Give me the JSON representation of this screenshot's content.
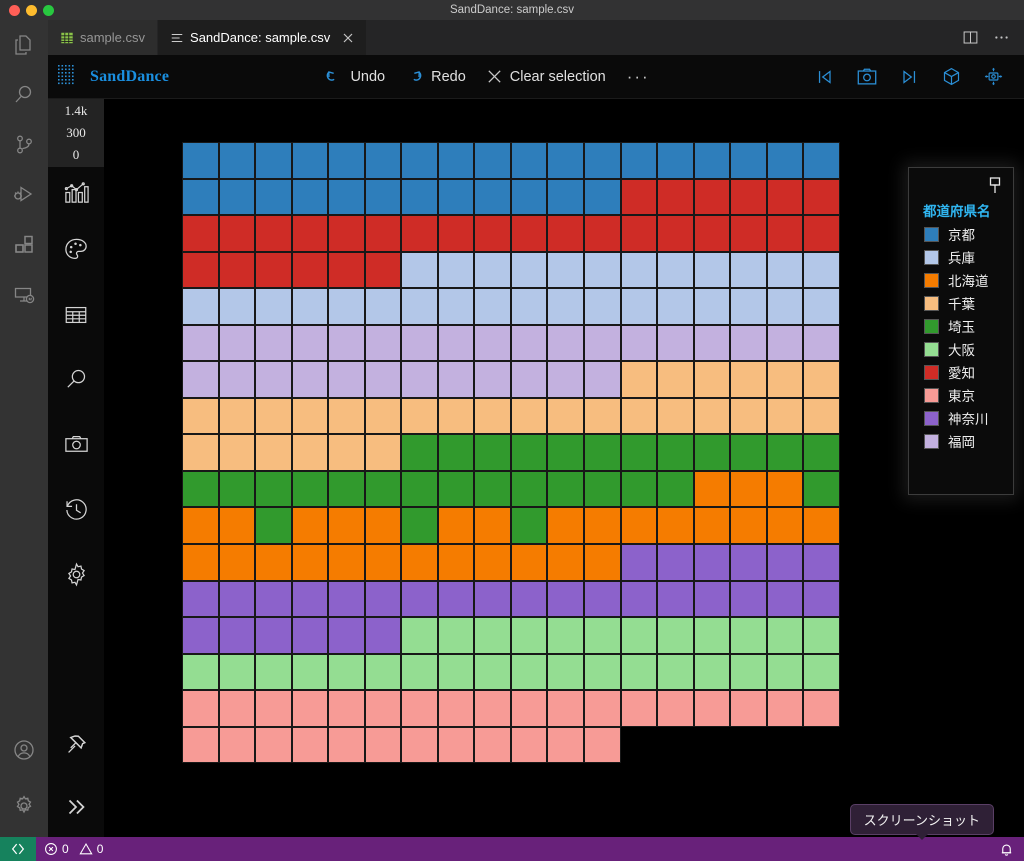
{
  "window": {
    "title": "SandDance: sample.csv"
  },
  "tabs": [
    {
      "label": "sample.csv",
      "icon": "csv-file-icon",
      "active": false,
      "closable": false
    },
    {
      "label": "SandDance: sample.csv",
      "icon": "sanddance-file-icon",
      "active": true,
      "closable": true
    }
  ],
  "tabbar_actions": [
    {
      "name": "split-editor-icon"
    },
    {
      "name": "more-actions-icon"
    }
  ],
  "activitybar": {
    "items": [
      {
        "name": "explorer-icon",
        "active": false
      },
      {
        "name": "search-icon",
        "active": false
      },
      {
        "name": "source-control-icon",
        "active": false
      },
      {
        "name": "run-and-debug-icon",
        "active": false
      },
      {
        "name": "extensions-icon",
        "active": false
      },
      {
        "name": "remote-explorer-icon",
        "active": false
      }
    ],
    "bottom": [
      {
        "name": "account-icon"
      },
      {
        "name": "manage-settings-icon"
      }
    ]
  },
  "sanddance": {
    "brand": "SandDance",
    "logo_icon": "sanddance-dot-matrix-logo",
    "toolbar": {
      "undo_label": "Undo",
      "redo_label": "Redo",
      "clear_selection_label": "Clear selection",
      "more_label": "···"
    },
    "toolbar_right_icons": [
      {
        "name": "previous-snapshot-icon"
      },
      {
        "name": "camera-snapshot-icon"
      },
      {
        "name": "next-snapshot-icon"
      },
      {
        "name": "chart-3d-cube-icon"
      },
      {
        "name": "camera-home-reset-icon"
      }
    ],
    "rail": {
      "axis_ticks": [
        "1.4k",
        "300",
        "0"
      ],
      "icons": [
        {
          "name": "chart-icon"
        },
        {
          "name": "color-palette-icon"
        },
        {
          "name": "data-grid-icon"
        },
        {
          "name": "search-icon"
        },
        {
          "name": "snapshot-camera-icon"
        },
        {
          "name": "history-icon"
        },
        {
          "name": "settings-gear-icon"
        }
      ],
      "bottom_icons": [
        {
          "name": "pin-icon"
        },
        {
          "name": "chevron-double-right-icon"
        }
      ]
    },
    "legend": {
      "pin_icon": "pin-icon",
      "title": "都道府県名",
      "entries": [
        {
          "label": "京都",
          "color": "#2e7ebb"
        },
        {
          "label": "兵庫",
          "color": "#b3c7e8"
        },
        {
          "label": "北海道",
          "color": "#f57c00"
        },
        {
          "label": "千葉",
          "color": "#f7bd7f"
        },
        {
          "label": "埼玉",
          "color": "#319a2d"
        },
        {
          "label": "大阪",
          "color": "#94dd92"
        },
        {
          "label": "愛知",
          "color": "#cf2c26"
        },
        {
          "label": "東京",
          "color": "#f79b96"
        },
        {
          "label": "神奈川",
          "color": "#8c62cb"
        },
        {
          "label": "福岡",
          "color": "#c3b1df"
        }
      ]
    }
  },
  "chart_data": {
    "type": "heatmap",
    "title": "",
    "xlabel": "",
    "ylabel": "",
    "grid": true,
    "columns": 18,
    "rows": 17,
    "legend_position": "right",
    "color_field": "都道府県名",
    "yaxis": {
      "ticks": [
        "1.4k",
        "300",
        "0"
      ],
      "ylim": [
        0,
        1400
      ]
    },
    "palette": {
      "kyoto": "#2e7ebb",
      "hyogo": "#b3c7e8",
      "hokkaido": "#f57c00",
      "chiba": "#f7bd7f",
      "saitama": "#319a2d",
      "osaka": "#94dd92",
      "aichi": "#cf2c26",
      "tokyo": "#f79b96",
      "kanagawa": "#8c62cb",
      "fukuoka": "#c3b1df"
    },
    "cells": [
      [
        "kyoto",
        "kyoto",
        "kyoto",
        "kyoto",
        "kyoto",
        "kyoto",
        "kyoto",
        "kyoto",
        "kyoto",
        "kyoto",
        "kyoto",
        "kyoto",
        "kyoto",
        "kyoto",
        "kyoto",
        "kyoto",
        "kyoto",
        "kyoto"
      ],
      [
        "kyoto",
        "kyoto",
        "kyoto",
        "kyoto",
        "kyoto",
        "kyoto",
        "kyoto",
        "kyoto",
        "kyoto",
        "kyoto",
        "kyoto",
        "kyoto",
        "aichi",
        "aichi",
        "aichi",
        "aichi",
        "aichi",
        "aichi"
      ],
      [
        "aichi",
        "aichi",
        "aichi",
        "aichi",
        "aichi",
        "aichi",
        "aichi",
        "aichi",
        "aichi",
        "aichi",
        "aichi",
        "aichi",
        "aichi",
        "aichi",
        "aichi",
        "aichi",
        "aichi",
        "aichi"
      ],
      [
        "aichi",
        "aichi",
        "aichi",
        "aichi",
        "aichi",
        "aichi",
        "hyogo",
        "hyogo",
        "hyogo",
        "hyogo",
        "hyogo",
        "hyogo",
        "hyogo",
        "hyogo",
        "hyogo",
        "hyogo",
        "hyogo",
        "hyogo"
      ],
      [
        "hyogo",
        "hyogo",
        "hyogo",
        "hyogo",
        "hyogo",
        "hyogo",
        "hyogo",
        "hyogo",
        "hyogo",
        "hyogo",
        "hyogo",
        "hyogo",
        "hyogo",
        "hyogo",
        "hyogo",
        "hyogo",
        "hyogo",
        "hyogo"
      ],
      [
        "fukuoka",
        "fukuoka",
        "fukuoka",
        "fukuoka",
        "fukuoka",
        "fukuoka",
        "fukuoka",
        "fukuoka",
        "fukuoka",
        "fukuoka",
        "fukuoka",
        "fukuoka",
        "fukuoka",
        "fukuoka",
        "fukuoka",
        "fukuoka",
        "fukuoka",
        "fukuoka"
      ],
      [
        "fukuoka",
        "fukuoka",
        "fukuoka",
        "fukuoka",
        "fukuoka",
        "fukuoka",
        "fukuoka",
        "fukuoka",
        "fukuoka",
        "fukuoka",
        "fukuoka",
        "fukuoka",
        "chiba",
        "chiba",
        "chiba",
        "chiba",
        "chiba",
        "chiba"
      ],
      [
        "chiba",
        "chiba",
        "chiba",
        "chiba",
        "chiba",
        "chiba",
        "chiba",
        "chiba",
        "chiba",
        "chiba",
        "chiba",
        "chiba",
        "chiba",
        "chiba",
        "chiba",
        "chiba",
        "chiba",
        "chiba"
      ],
      [
        "chiba",
        "chiba",
        "chiba",
        "chiba",
        "chiba",
        "chiba",
        "saitama",
        "saitama",
        "saitama",
        "saitama",
        "saitama",
        "saitama",
        "saitama",
        "saitama",
        "saitama",
        "saitama",
        "saitama",
        "saitama"
      ],
      [
        "saitama",
        "saitama",
        "saitama",
        "saitama",
        "saitama",
        "saitama",
        "saitama",
        "saitama",
        "saitama",
        "saitama",
        "saitama",
        "saitama",
        "saitama",
        "saitama",
        "hokkaido",
        "hokkaido",
        "hokkaido",
        "saitama"
      ],
      [
        "hokkaido",
        "hokkaido",
        "saitama",
        "hokkaido",
        "hokkaido",
        "hokkaido",
        "saitama",
        "hokkaido",
        "hokkaido",
        "saitama",
        "hokkaido",
        "hokkaido",
        "hokkaido",
        "hokkaido",
        "hokkaido",
        "hokkaido",
        "hokkaido",
        "hokkaido"
      ],
      [
        "hokkaido",
        "hokkaido",
        "hokkaido",
        "hokkaido",
        "hokkaido",
        "hokkaido",
        "hokkaido",
        "hokkaido",
        "hokkaido",
        "hokkaido",
        "hokkaido",
        "hokkaido",
        "kanagawa",
        "kanagawa",
        "kanagawa",
        "kanagawa",
        "kanagawa",
        "kanagawa"
      ],
      [
        "kanagawa",
        "kanagawa",
        "kanagawa",
        "kanagawa",
        "kanagawa",
        "kanagawa",
        "kanagawa",
        "kanagawa",
        "kanagawa",
        "kanagawa",
        "kanagawa",
        "kanagawa",
        "kanagawa",
        "kanagawa",
        "kanagawa",
        "kanagawa",
        "kanagawa",
        "kanagawa"
      ],
      [
        "kanagawa",
        "kanagawa",
        "kanagawa",
        "kanagawa",
        "kanagawa",
        "kanagawa",
        "osaka",
        "osaka",
        "osaka",
        "osaka",
        "osaka",
        "osaka",
        "osaka",
        "osaka",
        "osaka",
        "osaka",
        "osaka",
        "osaka"
      ],
      [
        "osaka",
        "osaka",
        "osaka",
        "osaka",
        "osaka",
        "osaka",
        "osaka",
        "osaka",
        "osaka",
        "osaka",
        "osaka",
        "osaka",
        "osaka",
        "osaka",
        "osaka",
        "osaka",
        "osaka",
        "osaka"
      ],
      [
        "tokyo",
        "tokyo",
        "tokyo",
        "tokyo",
        "tokyo",
        "tokyo",
        "tokyo",
        "tokyo",
        "tokyo",
        "tokyo",
        "tokyo",
        "tokyo",
        "tokyo",
        "tokyo",
        "tokyo",
        "tokyo",
        "tokyo",
        "tokyo"
      ],
      [
        "tokyo",
        "tokyo",
        "tokyo",
        "tokyo",
        "tokyo",
        "tokyo",
        "tokyo",
        "tokyo",
        "tokyo",
        "tokyo",
        "tokyo",
        "tokyo",
        "empty",
        "empty",
        "empty",
        "empty",
        "empty",
        "empty"
      ]
    ]
  },
  "statusbar": {
    "remote_icon": "remote-window-icon",
    "errors_icon": "error-icon",
    "errors_count": "0",
    "warnings_icon": "warning-icon",
    "warnings_count": "0",
    "bell_icon": "notifications-bell-icon"
  },
  "tooltip": {
    "text": "スクリーンショット"
  }
}
